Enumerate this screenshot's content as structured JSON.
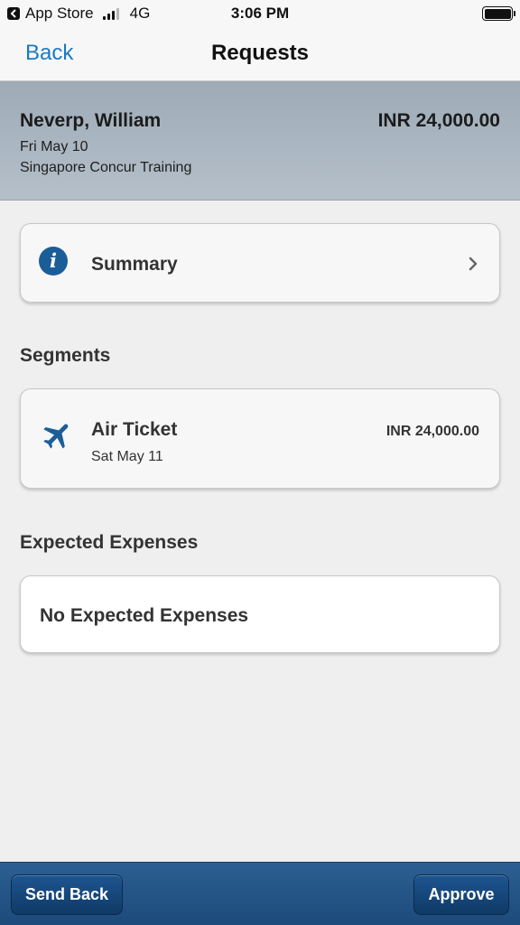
{
  "status_bar": {
    "back_app_label": "App Store",
    "network": "4G",
    "time": "3:06 PM",
    "signal_bars_filled": 3,
    "signal_bars_total": 4,
    "battery_level": 1.0
  },
  "nav": {
    "back_label": "Back",
    "title": "Requests"
  },
  "request": {
    "name": "Neverp, William",
    "amount": "INR 24,000.00",
    "date": "Fri May 10",
    "trip": "Singapore Concur Training"
  },
  "summary": {
    "label": "Summary",
    "icon": "info-icon"
  },
  "segments": {
    "title": "Segments",
    "items": [
      {
        "icon": "airplane-icon",
        "title": "Air Ticket",
        "date": "Sat May 11",
        "amount": "INR 24,000.00"
      }
    ]
  },
  "expenses": {
    "title": "Expected Expenses",
    "empty_label": "No Expected Expenses"
  },
  "toolbar": {
    "send_back_label": "Send Back",
    "approve_label": "Approve"
  },
  "colors": {
    "accent_link": "#1a7ac4",
    "header_band": "#aab5c0",
    "toolbar": "#1f4e80",
    "icon_blue": "#1b5d97"
  }
}
